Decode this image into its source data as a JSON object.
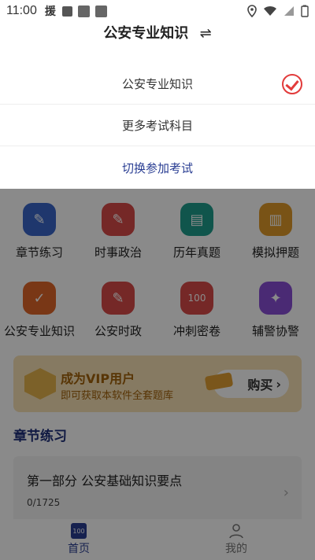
{
  "statusbar": {
    "time": "11:00",
    "app_glyph": "援"
  },
  "sheet": {
    "title": "公安专业知识",
    "swap_icon": "⇌",
    "options": [
      {
        "label": "公安专业知识",
        "selected": true
      },
      {
        "label": "更多考试科目"
      },
      {
        "label": "切换参加考试"
      }
    ]
  },
  "grid": [
    {
      "label": "章节练习",
      "icon": "pencil-icon",
      "color": "#3a67c9"
    },
    {
      "label": "时事政治",
      "icon": "edit-icon",
      "color": "#d84b48"
    },
    {
      "label": "历年真题",
      "icon": "document-icon",
      "color": "#1f9e8c"
    },
    {
      "label": "模拟押题",
      "icon": "paper-icon",
      "color": "#e09a2a"
    },
    {
      "label": "公安专业知识",
      "icon": "board-icon",
      "color": "#e0662a"
    },
    {
      "label": "公安时政",
      "icon": "edit-icon",
      "color": "#d84b48"
    },
    {
      "label": "冲刺密卷",
      "icon": "score-100-icon",
      "color": "#d84b48"
    },
    {
      "label": "辅警协警",
      "icon": "badge-icon",
      "color": "#8a4fd6"
    }
  ],
  "vip": {
    "title": "成为VIP用户",
    "subtitle": "即可获取本软件全套题库",
    "button": "购买"
  },
  "section": {
    "title": "章节练习"
  },
  "card": {
    "title": "第一部分 公安基础知识要点",
    "progress": "0/1725"
  },
  "nav": {
    "home": "首页",
    "mine": "我的",
    "home_badge": "100"
  }
}
